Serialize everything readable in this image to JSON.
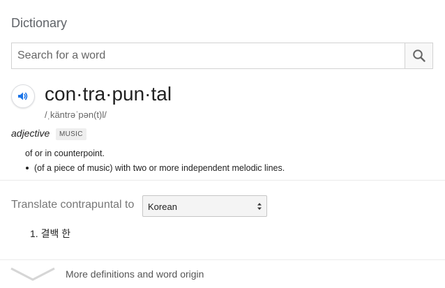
{
  "card": {
    "title": "Dictionary"
  },
  "search": {
    "placeholder": "Search for a word",
    "value": ""
  },
  "entry": {
    "headword": "con·tra·pun·tal",
    "phonetic": "/ˌkäntrəˈpən(t)l/",
    "part_of_speech": "adjective",
    "label": "MUSIC",
    "definitions": [
      "of or in counterpoint.",
      "(of a piece of music) with two or more independent melodic lines."
    ]
  },
  "translate": {
    "label": "Translate contrapuntal to",
    "selected_language": "Korean",
    "results": [
      "1. 결백 한"
    ]
  },
  "more": {
    "label": "More definitions and word origin"
  },
  "colors": {
    "accent_blue": "#4285f4",
    "text": "#222222",
    "muted": "#777777"
  }
}
